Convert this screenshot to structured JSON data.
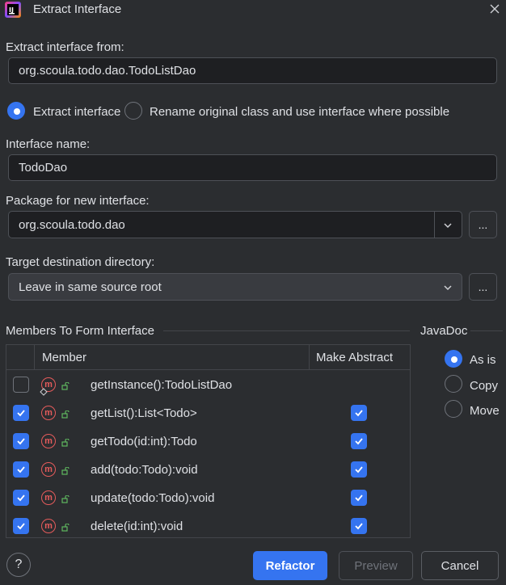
{
  "window": {
    "title": "Extract Interface"
  },
  "extract_from": {
    "label": "Extract interface from:",
    "value": "org.scoula.todo.dao.TodoListDao"
  },
  "mode": {
    "option1": "Extract interface",
    "option2": "Rename original class and use interface where possible"
  },
  "interface_name": {
    "label": "Interface name:",
    "value": "TodoDao"
  },
  "package": {
    "label": "Package for new interface:",
    "value": "org.scoula.todo.dao",
    "browse": "..."
  },
  "target_dir": {
    "label": "Target destination directory:",
    "value": "Leave in same source root",
    "browse": "..."
  },
  "members": {
    "section_title": "Members To Form Interface",
    "col_member": "Member",
    "col_abstract": "Make Abstract",
    "rows": [
      {
        "signature": "getInstance():TodoListDao",
        "checked": false,
        "abstract": false
      },
      {
        "signature": "getList():List<Todo>",
        "checked": true,
        "abstract": true
      },
      {
        "signature": "getTodo(id:int):Todo",
        "checked": true,
        "abstract": true
      },
      {
        "signature": "add(todo:Todo):void",
        "checked": true,
        "abstract": true
      },
      {
        "signature": "update(todo:Todo):void",
        "checked": true,
        "abstract": true
      },
      {
        "signature": "delete(id:int):void",
        "checked": true,
        "abstract": true
      }
    ]
  },
  "javadoc": {
    "title": "JavaDoc",
    "as_is": "As is",
    "copy": "Copy",
    "move": "Move"
  },
  "buttons": {
    "help": "?",
    "refactor": "Refactor",
    "preview": "Preview",
    "cancel": "Cancel"
  },
  "colors": {
    "accent": "#3574f0",
    "background": "#2b2d30",
    "method_icon": "#e55b5b",
    "lock_icon": "#5fb85f"
  }
}
